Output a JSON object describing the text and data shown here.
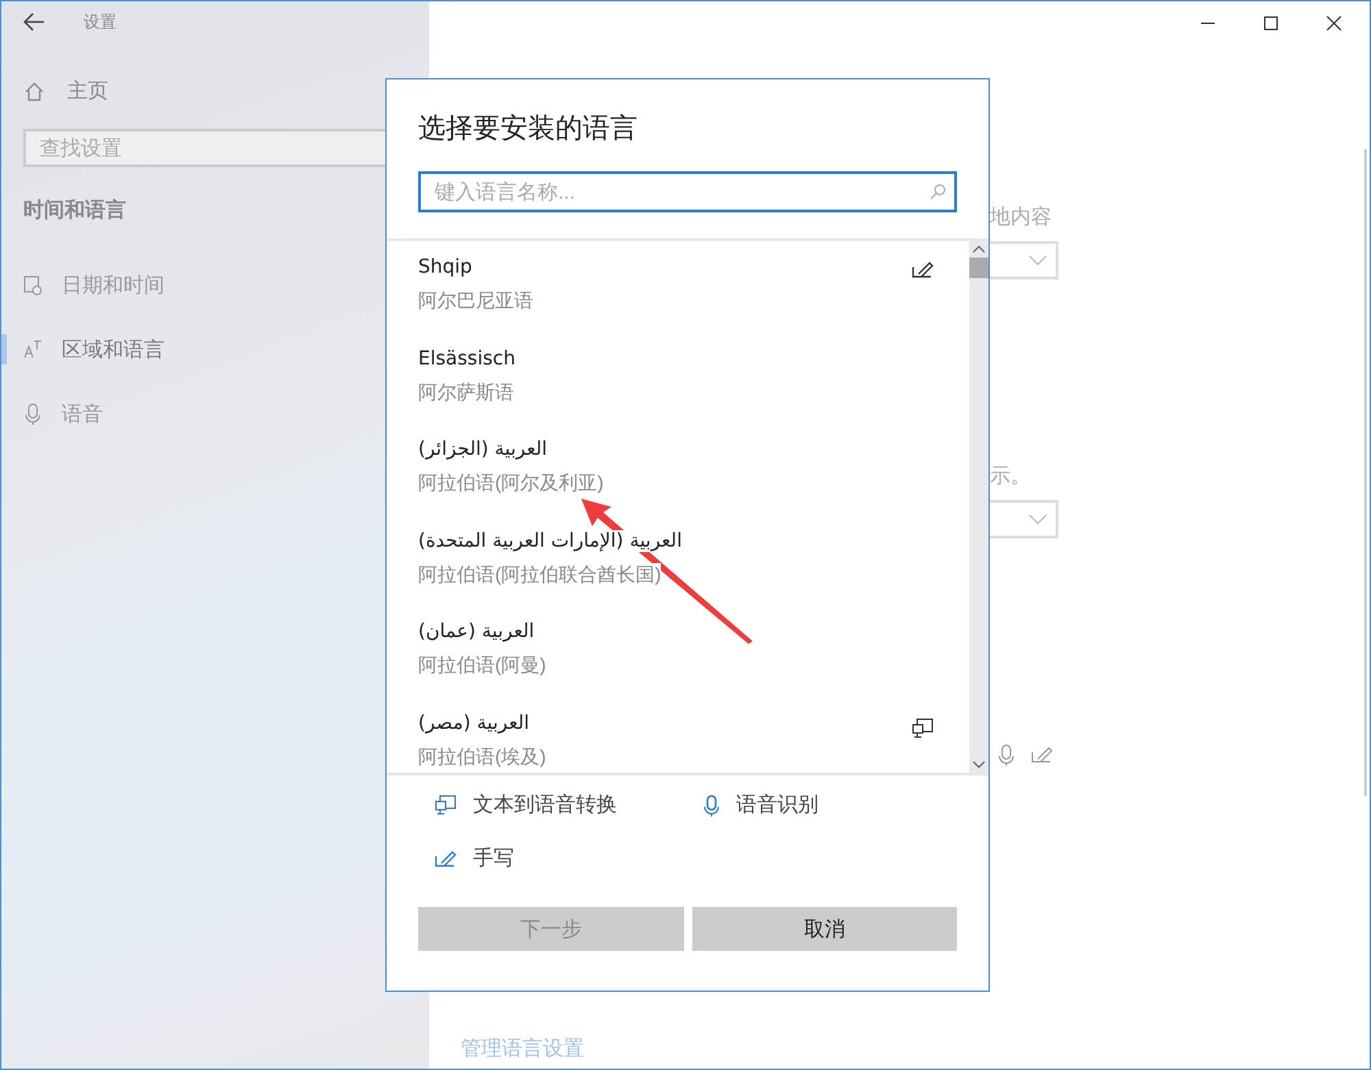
{
  "window": {
    "title": "设置"
  },
  "sidebar": {
    "home": "主页",
    "search": {
      "placeholder": "查找设置"
    },
    "section": "时间和语言",
    "items": [
      {
        "label": "日期和时间",
        "selected": false
      },
      {
        "label": "区域和语言",
        "selected": true
      },
      {
        "label": "语音",
        "selected": false
      }
    ]
  },
  "background": {
    "texts": [
      {
        "kind": "label",
        "text": "地内容"
      },
      {
        "kind": "dropdown"
      },
      {
        "kind": "label",
        "text": "示。"
      },
      {
        "kind": "dropdown"
      },
      {
        "kind": "icons"
      }
    ],
    "links": [
      "管理语言设置"
    ]
  },
  "dialog": {
    "title": "选择要安装的语言",
    "search": {
      "placeholder": "键入语言名称..."
    },
    "languages": [
      {
        "name": "Shqip",
        "translation": "阿尔巴尼亚语",
        "handwriting": true,
        "tts": false
      },
      {
        "name": "Elsässisch",
        "translation": "阿尔萨斯语",
        "handwriting": false,
        "tts": false
      },
      {
        "name": "العربية (الجزائر)",
        "translation": "阿拉伯语(阿尔及利亚)",
        "handwriting": false,
        "tts": false
      },
      {
        "name": "العربية (الإمارات العربية المتحدة)",
        "translation": "阿拉伯语(阿拉伯联合酋长国)",
        "handwriting": false,
        "tts": false
      },
      {
        "name": "العربية (عمان)",
        "translation": "阿拉伯语(阿曼)",
        "handwriting": false,
        "tts": false
      },
      {
        "name": "العربية (مصر)",
        "translation": "阿拉伯语(埃及)",
        "handwriting": false,
        "tts": true
      }
    ],
    "legend": [
      {
        "kind": "tts",
        "label": "文本到语音转换"
      },
      {
        "kind": "speech",
        "label": "语音识别"
      },
      {
        "kind": "handwriting",
        "label": "手写"
      }
    ],
    "buttons": [
      {
        "label": "下一步",
        "disabled": true
      },
      {
        "label": "取消",
        "disabled": false
      }
    ]
  }
}
